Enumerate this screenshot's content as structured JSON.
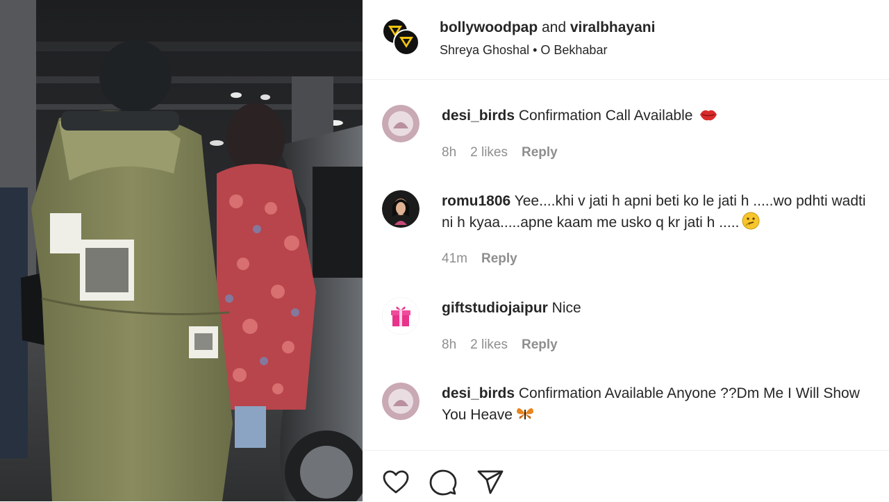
{
  "header": {
    "user1": "bollywoodpap",
    "joiner": " and ",
    "user2": "viralbhayani",
    "audio_artist": "Shreya Ghoshal",
    "audio_sep": " • ",
    "audio_title": "O Bekhabar"
  },
  "comments": [
    {
      "username": "desi_birds",
      "text": " Confirmation Call Available ",
      "emoji": "lips-icon",
      "time": "8h",
      "likes": "2 likes",
      "reply": "Reply"
    },
    {
      "username": "romu1806",
      "text": " Yee....khi v jati h apni beti ko le jati h .....wo pdhti wadti ni h kyaa.....apne kaam me usko q kr jati h .....",
      "emoji": "thinking-face-icon",
      "time": "41m",
      "likes": "",
      "reply": "Reply"
    },
    {
      "username": "giftstudiojaipur",
      "text": " Nice",
      "emoji": "",
      "time": "8h",
      "likes": "2 likes",
      "reply": "Reply"
    },
    {
      "username": "desi_birds",
      "text": " Confirmation Available Anyone ??Dm Me I Will Show You Heave",
      "emoji": "butterfly-icon"
    }
  ],
  "actions": {
    "like_icon": "heart-icon",
    "comment_icon": "comment-icon",
    "share_icon": "share-icon"
  },
  "colors": {
    "text": "#262626",
    "muted": "#8e8e8e",
    "divider": "#efefef",
    "badge_yellow": "#f2c511"
  }
}
